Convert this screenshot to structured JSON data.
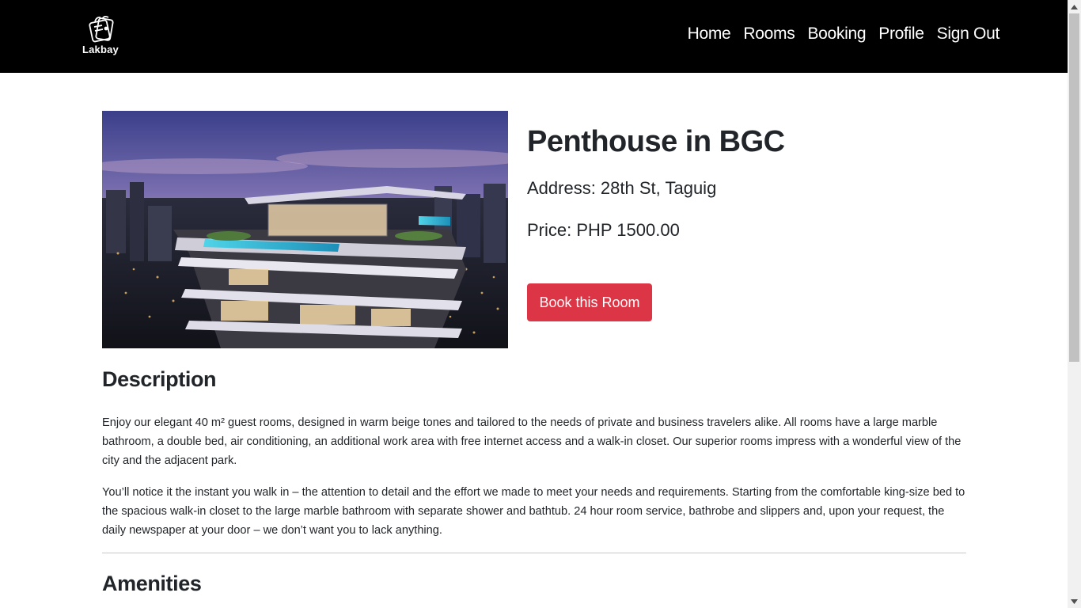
{
  "brand": {
    "name": "Lakbay",
    "logo_icon": "luggage-icon"
  },
  "nav": {
    "items": [
      {
        "label": "Home"
      },
      {
        "label": "Rooms"
      },
      {
        "label": "Booking"
      },
      {
        "label": "Profile"
      },
      {
        "label": "Sign Out"
      }
    ]
  },
  "room": {
    "title": "Penthouse in BGC",
    "address": "Address: 28th St, Taguig",
    "price": "Price: PHP 1500.00",
    "book_label": "Book this Room",
    "image_desc_icon": "penthouse-photo"
  },
  "description": {
    "heading": "Description",
    "paragraphs": [
      "Enjoy our elegant 40 m² guest rooms, designed in warm beige tones and tailored to the needs of private and business travelers alike. All rooms have a large marble bathroom, a double bed, air conditioning, an additional work area with free internet access and a walk-in closet. Our superior rooms impress with a wonderful view of the city and the adjacent park.",
      "You’ll notice it the instant you walk in – the attention to detail and the effort we made to meet your needs and requirements. Starting from the comfortable king-size bed to the spacious walk-in closet to the large marble bathroom with separate shower and bathtub. 24 hour room service, bathrobe and slippers and, upon your request, the daily newspaper at your door – we don’t want you to lack anything."
    ]
  },
  "amenities": {
    "heading": "Amenities"
  },
  "colors": {
    "navbar": "#000000",
    "accent_button": "#dc3545",
    "text": "#212529"
  }
}
